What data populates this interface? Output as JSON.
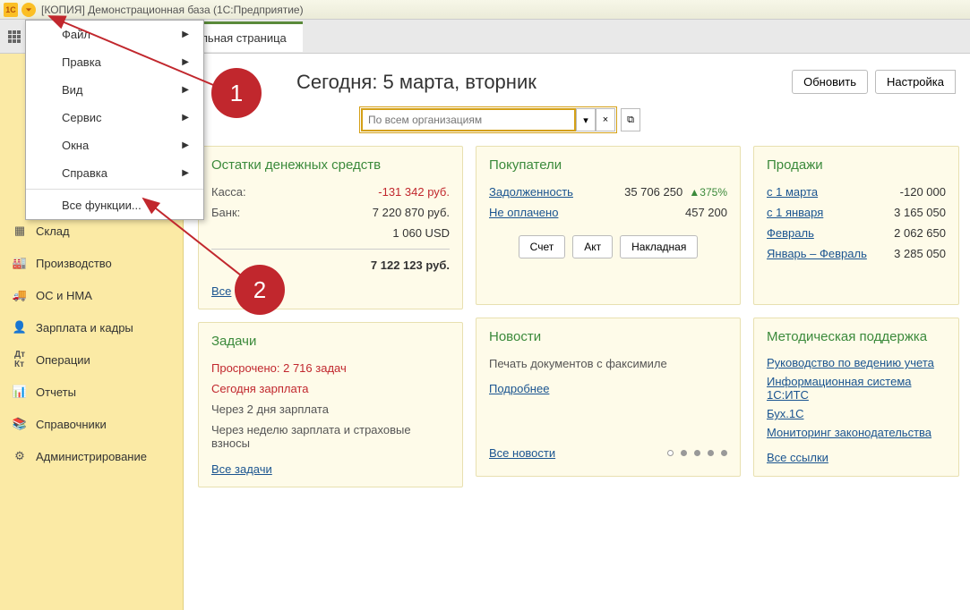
{
  "titlebar": {
    "title": "[КОПИЯ] Демонстрационная база  (1С:Предприятие)"
  },
  "tab": {
    "label": "Начальная страница"
  },
  "menu": {
    "items": [
      {
        "label": "Файл",
        "hasSub": true
      },
      {
        "label": "Правка",
        "hasSub": true
      },
      {
        "label": "Вид",
        "hasSub": true
      },
      {
        "label": "Сервис",
        "hasSub": true
      },
      {
        "label": "Окна",
        "hasSub": true
      },
      {
        "label": "Справка",
        "hasSub": true
      }
    ],
    "allFunctions": "Все функции..."
  },
  "sidebar": {
    "items": [
      {
        "key": "warehouse",
        "label": "Склад"
      },
      {
        "key": "production",
        "label": "Производство"
      },
      {
        "key": "fixed-assets",
        "label": "ОС и НМА"
      },
      {
        "key": "salary",
        "label": "Зарплата и кадры"
      },
      {
        "key": "operations",
        "label": "Операции"
      },
      {
        "key": "reports",
        "label": "Отчеты"
      },
      {
        "key": "directories",
        "label": "Справочники"
      },
      {
        "key": "admin",
        "label": "Администрирование"
      }
    ]
  },
  "header": {
    "today": "Сегодня: 5 марта, вторник",
    "refresh": "Обновить",
    "settings": "Настройка",
    "orgPlaceholder": "По всем организациям"
  },
  "balances": {
    "title": "Остатки денежных средств",
    "cashLabel": "Касса:",
    "cashVal": "-131 342 руб.",
    "bankLabel": "Банк:",
    "bankVal": "7 220 870 руб.",
    "usdVal": "1 060 USD",
    "totalVal": "7 122 123 руб.",
    "all": "Все"
  },
  "buyers": {
    "title": "Покупатели",
    "debtLabel": "Задолженность",
    "debtVal": "35 706 250",
    "debtTrend": "▲375%",
    "unpaidLabel": "Не оплачено",
    "unpaidVal": "457 200",
    "btnInvoice": "Счет",
    "btnAct": "Акт",
    "btnWaybill": "Накладная"
  },
  "sales": {
    "title": "Продажи",
    "rows": [
      {
        "label": "с 1 марта",
        "val": "-120 000"
      },
      {
        "label": "с 1 января",
        "val": "3 165 050"
      },
      {
        "label": "Февраль",
        "val": "2 062 650"
      },
      {
        "label": "Январь – Февраль",
        "val": "3 285 050"
      }
    ]
  },
  "tasks": {
    "title": "Задачи",
    "overdue": "Просрочено: 2 716 задач",
    "todaySalary": "Сегодня зарплата",
    "in2days": "Через 2 дня зарплата",
    "inWeek": "Через неделю зарплата и страховые взносы",
    "all": "Все задачи"
  },
  "news": {
    "title": "Новости",
    "text": "Печать документов с факсимиле",
    "more": "Подробнее",
    "all": "Все новости"
  },
  "support": {
    "title": "Методическая поддержка",
    "links": [
      "Руководство по ведению учета",
      "Информационная система 1С:ИТС",
      "Бух.1С",
      "Мониторинг законодательства"
    ],
    "all": "Все ссылки"
  },
  "annotations": {
    "one": "1",
    "two": "2"
  }
}
